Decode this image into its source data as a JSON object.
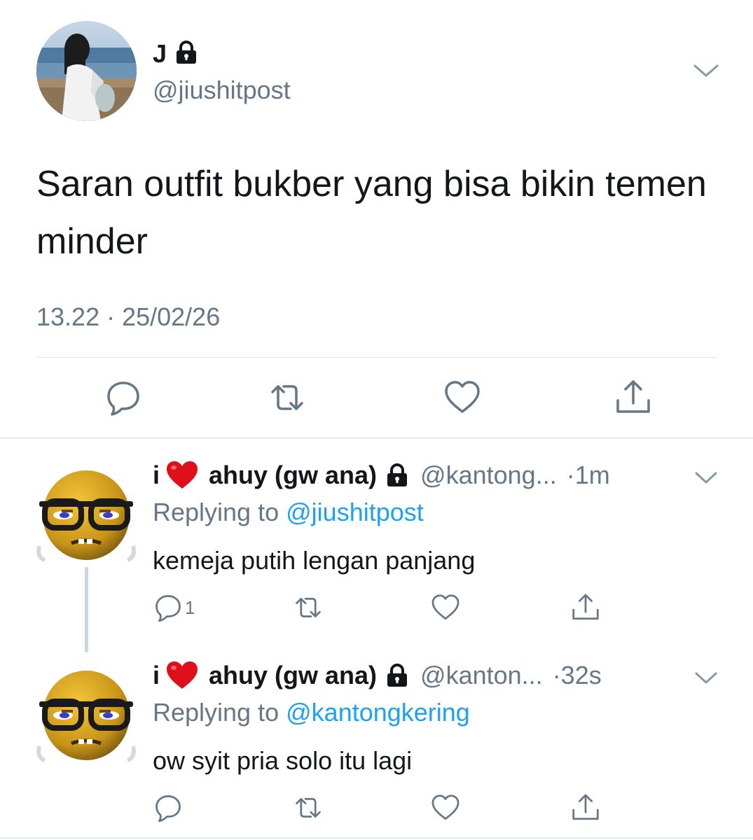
{
  "colors": {
    "text": "#14171a",
    "secondary": "#657786",
    "link": "#1da1f2",
    "divider": "#e1e8ed"
  },
  "main_tweet": {
    "display_name": "J",
    "handle": "@jiushitpost",
    "text": "Saran outfit bukber yang bisa bikin temen minder",
    "timestamp": "13.22 · 25/02/26",
    "icons": {
      "lock": "lock-icon",
      "more": "chevron-down-icon",
      "reply": "reply-icon",
      "retweet": "retweet-icon",
      "like": "heart-icon",
      "share": "share-icon"
    }
  },
  "replies": [
    {
      "name_prefix": "i",
      "name_emoji": "heart-emoji",
      "name_suffix": "ahuy (gw ana)",
      "handle": "@kantong...",
      "time": "·1m",
      "replying_label": "Replying to",
      "replying_to": "@jiushitpost",
      "text": "kemeja putih lengan panjang",
      "reply_count": "1"
    },
    {
      "name_prefix": "i",
      "name_emoji": "heart-emoji",
      "name_suffix": "ahuy (gw ana)",
      "handle": "@kanton...",
      "time": "·32s",
      "replying_label": "Replying to",
      "replying_to": "@kantongkering",
      "text": "ow syit pria solo itu lagi",
      "reply_count": ""
    }
  ]
}
